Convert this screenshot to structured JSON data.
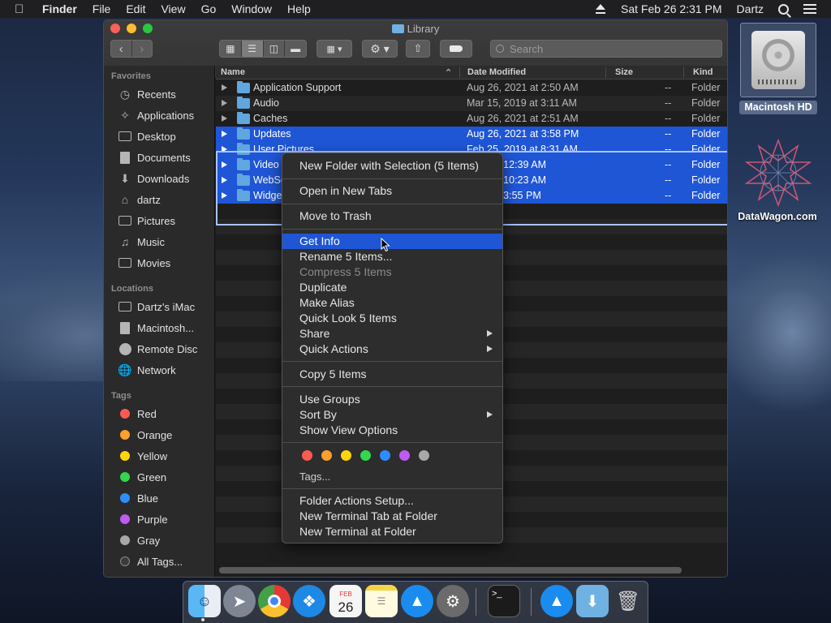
{
  "menubar": {
    "app": "Finder",
    "items": [
      "File",
      "Edit",
      "View",
      "Go",
      "Window",
      "Help"
    ],
    "clock": "Sat Feb 26  2:31 PM",
    "user": "Dartz"
  },
  "window": {
    "title": "Library",
    "search_placeholder": "Search",
    "columns": {
      "name": "Name",
      "date": "Date Modified",
      "size": "Size",
      "kind": "Kind"
    }
  },
  "sidebar": {
    "favorites_header": "Favorites",
    "favorites": [
      "Recents",
      "Applications",
      "Desktop",
      "Documents",
      "Downloads",
      "dartz",
      "Pictures",
      "Music",
      "Movies"
    ],
    "locations_header": "Locations",
    "locations": [
      "Dartz's iMac",
      "Macintosh...",
      "Remote Disc",
      "Network"
    ],
    "tags_header": "Tags",
    "tags": [
      {
        "label": "Red",
        "color": "#ff5a52"
      },
      {
        "label": "Orange",
        "color": "#ff9f2e"
      },
      {
        "label": "Yellow",
        "color": "#ffd60a"
      },
      {
        "label": "Green",
        "color": "#32d74b"
      },
      {
        "label": "Blue",
        "color": "#2f8cff"
      },
      {
        "label": "Purple",
        "color": "#bf5af2"
      },
      {
        "label": "Gray",
        "color": "#a8a8a8"
      },
      {
        "label": "All Tags...",
        "color": "#5a5a5a"
      }
    ]
  },
  "files": [
    {
      "name": "Application Support",
      "date": "Aug 26, 2021 at 2:50 AM",
      "size": "--",
      "kind": "Folder"
    },
    {
      "name": "Audio",
      "date": "Mar 15, 2019 at 3:11 AM",
      "size": "--",
      "kind": "Folder"
    },
    {
      "name": "Caches",
      "date": "Aug 26, 2021 at 2:51 AM",
      "size": "--",
      "kind": "Folder"
    },
    {
      "name": "Updates",
      "date": "Aug 26, 2021 at 3:58 PM",
      "size": "--",
      "kind": "Folder"
    },
    {
      "name": "User Pictures",
      "date": "Feb 25, 2019 at 8:31 AM",
      "size": "--",
      "kind": "Folder"
    },
    {
      "name": "Video",
      "date": "2019 at 12:39 AM",
      "size": "--",
      "kind": "Folder"
    },
    {
      "name": "WebSe",
      "date": "2019 at 10:23 AM",
      "size": "--",
      "kind": "Folder"
    },
    {
      "name": "Widge",
      "date": "2021 at 3:55 PM",
      "size": "--",
      "kind": "Folder"
    }
  ],
  "context_menu": {
    "new_folder": "New Folder with Selection (5 Items)",
    "open_tabs": "Open in New Tabs",
    "trash": "Move to Trash",
    "get_info": "Get Info",
    "rename": "Rename 5 Items...",
    "compress": "Compress 5 Items",
    "duplicate": "Duplicate",
    "alias": "Make Alias",
    "quicklook": "Quick Look 5 Items",
    "share": "Share",
    "quick_actions": "Quick Actions",
    "copy": "Copy 5 Items",
    "use_groups": "Use Groups",
    "sort_by": "Sort By",
    "view_options": "Show View Options",
    "tag_colors": [
      "#ff5a52",
      "#ff9f2e",
      "#ffd60a",
      "#32d74b",
      "#2f8cff",
      "#bf5af2",
      "#a8a8a8"
    ],
    "tags": "Tags...",
    "folder_actions": "Folder Actions Setup...",
    "terminal_tab": "New Terminal Tab at Folder",
    "terminal": "New Terminal at Folder"
  },
  "desktop": {
    "hd_label": "Macintosh HD",
    "datawagon_label": "DataWagon.com"
  },
  "dock": {
    "calendar_month": "FEB",
    "calendar_day": "26"
  }
}
